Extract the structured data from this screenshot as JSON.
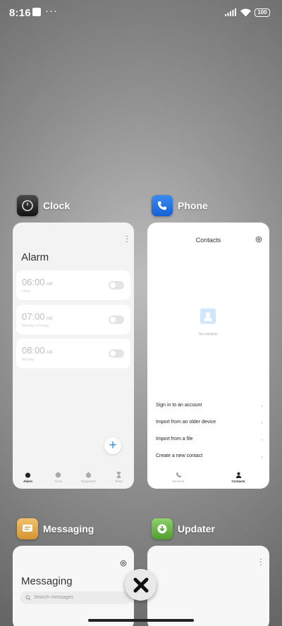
{
  "status_bar": {
    "time": "8:16",
    "battery": "100"
  },
  "apps": {
    "clock": {
      "name": "Clock",
      "screen_title": "Alarm",
      "alarms": [
        {
          "time": "06:00",
          "ampm": "AM",
          "sub": "Once"
        },
        {
          "time": "07:00",
          "ampm": "AM",
          "sub": "Monday to Friday"
        },
        {
          "time": "08:00",
          "ampm": "AM",
          "sub": "Monday"
        }
      ],
      "tabs": [
        "Alarm",
        "Clock",
        "Stopwatch",
        "Timer"
      ]
    },
    "phone": {
      "name": "Phone",
      "screen_title": "Contacts",
      "empty_text": "No contacts",
      "options": [
        "Sign in to an account",
        "Import from an older device",
        "Import from a file",
        "Create a new contact"
      ],
      "tabs": [
        "Recents",
        "Contacts"
      ]
    },
    "messaging": {
      "name": "Messaging",
      "screen_title": "Messaging",
      "search_placeholder": "Search messages"
    },
    "updater": {
      "name": "Updater"
    }
  },
  "colors": {
    "accent": "#2c8cf4"
  }
}
